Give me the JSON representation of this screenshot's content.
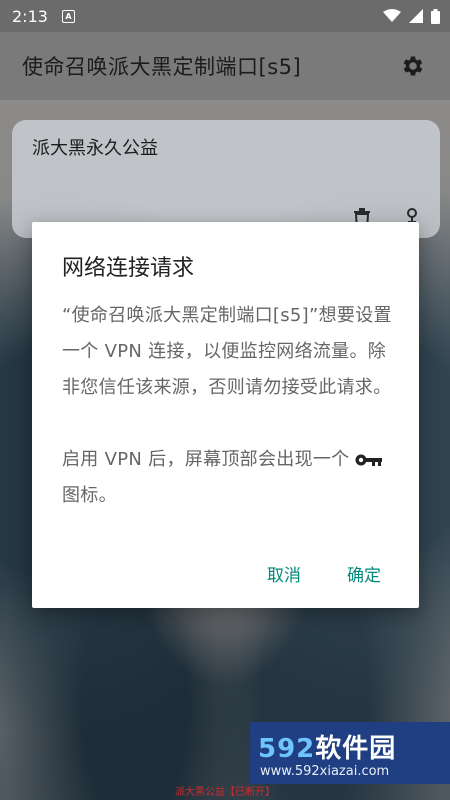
{
  "status_bar": {
    "time": "2:13",
    "notification_icon": "a-icon"
  },
  "app_bar": {
    "title": "使命召唤派大黑定制端口[s5]",
    "settings_icon": "gear-icon"
  },
  "card": {
    "title": "派大黑永久公益"
  },
  "dialog": {
    "title": "网络连接请求",
    "message_1": "“使命召唤派大黑定制端口[s5]”想要设置一个 VPN 连接，以便监控网络流量。除非您信任该来源，否则请勿接受此请求。",
    "message_2_before": "启用 VPN 后，屏幕顶部会出现一个",
    "message_2_after": "图标。",
    "cancel_label": "取消",
    "confirm_label": "确定"
  },
  "bottom_status": "派大黑公益【已断开】",
  "watermark": {
    "brand_num": "592",
    "brand_text": "软件园",
    "url": "www.592xiazai.com"
  },
  "colors": {
    "accent": "#00897b",
    "status_red": "#d12b2b"
  }
}
